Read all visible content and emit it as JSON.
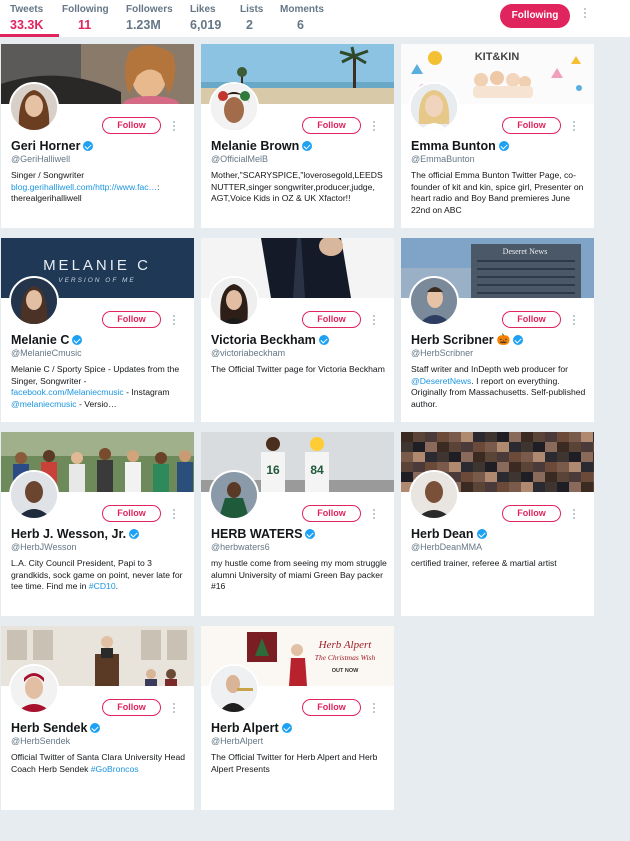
{
  "stats": {
    "tweets": {
      "label": "Tweets",
      "value": "33.3K"
    },
    "following": {
      "label": "Following",
      "value": "11"
    },
    "followers": {
      "label": "Followers",
      "value": "1.23M"
    },
    "likes": {
      "label": "Likes",
      "value": "6,019"
    },
    "lists": {
      "label": "Lists",
      "value": "2"
    },
    "moments": {
      "label": "Moments",
      "value": "6"
    }
  },
  "profile_action": {
    "following_label": "Following"
  },
  "colors": {
    "accent": "#e0245e",
    "link": "#1b95e0",
    "verified": "#1da1f2",
    "background": "#e6ecf0"
  },
  "cards": [
    {
      "name": "Geri Horner",
      "handle": "@GeriHalliwell",
      "verified": true,
      "follow_label": "Follow",
      "bio": [
        "Singer / Songwriter"
      ],
      "bio_link": "blog.gerihalliwell.com/http://www.fac…",
      "bio_tail": ": therealgerihalliwell"
    },
    {
      "name": "Melanie Brown",
      "handle": "@OfficialMelB",
      "verified": true,
      "follow_label": "Follow",
      "bio_text": "Mother,\"SCARYSPICE,\"loverosegold,LEEDSNUTTER,singer songwriter,producer,judge, AGT,Voice Kids in OZ & UK Xfactor!!"
    },
    {
      "name": "Emma Bunton",
      "handle": "@EmmaBunton",
      "verified": true,
      "follow_label": "Follow",
      "bio_text": "The official Emma Bunton Twitter Page, co-founder of kit and kin, spice girl, Presenter on heart radio and Boy Band premieres June 22nd on ABC",
      "banner_text": "KIT&KIN"
    },
    {
      "name": "Melanie C",
      "handle": "@MelanieCmusic",
      "verified": true,
      "follow_label": "Follow",
      "bio_a": "Melanie C / Sporty Spice - Updates from the Singer, Songwriter -",
      "bio_link1": "facebook.com/Melaniecmusic",
      "bio_b": " - Instagram ",
      "bio_link2": "@melaniecmusic",
      "bio_c": " - Versio…",
      "banner_title": "MELANIE C",
      "banner_sub": "VERSION OF ME"
    },
    {
      "name": "Victoria Beckham",
      "handle": "@victoriabeckham",
      "verified": true,
      "follow_label": "Follow",
      "bio_text": "The Official Twitter page for Victoria Beckham"
    },
    {
      "name": "Herb Scribner",
      "handle": "@HerbScribner",
      "verified": true,
      "follow_label": "Follow",
      "bio_a": "Staff writer and InDepth web producer for ",
      "bio_link1": "@DeseretNews",
      "bio_b": ". I report on everything. Originally from Massachusetts. Self-published author.",
      "banner_text": "Deseret News"
    },
    {
      "name": "Herb J. Wesson, Jr.",
      "handle": "@HerbJWesson",
      "verified": true,
      "follow_label": "Follow",
      "bio_a": "L.A. City Council President, Papi to 3 grandkids, sock game on point, never late for tee time. Find me in ",
      "bio_link1": "#CD10",
      "bio_b": "."
    },
    {
      "name": "HERB WATERS",
      "handle": "@herbwaters6",
      "verified": true,
      "follow_label": "Follow",
      "bio_text": "my hustle come from seeing my mom struggle alumni University of miami Green Bay packer #16",
      "jersey_numbers": [
        "16",
        "84"
      ]
    },
    {
      "name": "Herb Dean",
      "handle": "@HerbDeanMMA",
      "verified": true,
      "follow_label": "Follow",
      "bio_text": "certified trainer, referee & martial artist"
    },
    {
      "name": "Herb Sendek",
      "handle": "@HerbSendek",
      "verified": true,
      "follow_label": "Follow",
      "bio_a": "Official Twitter of Santa Clara University Head Coach Herb Sendek ",
      "bio_link1": "#GoBroncos"
    },
    {
      "name": "Herb Alpert",
      "handle": "@HerbAlpert",
      "verified": true,
      "follow_label": "Follow",
      "bio_text": "The Official Twitter for Herb Alpert and Herb Alpert Presents",
      "banner_title": "Herb Alpert",
      "banner_sub": "The Christmas Wish",
      "banner_cta": "OUT NOW"
    }
  ]
}
